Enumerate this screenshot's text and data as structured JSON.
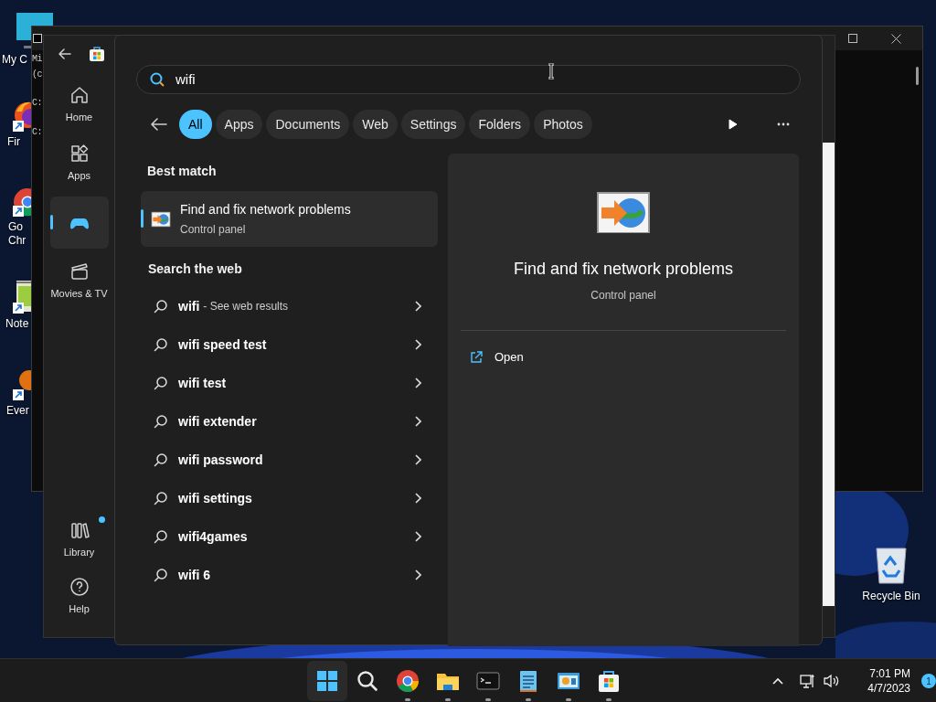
{
  "desktop": {
    "icons": [
      {
        "kind": "computer",
        "label_lines": [
          "My C"
        ]
      },
      {
        "kind": "firefox",
        "label_lines": [
          "Fir"
        ]
      },
      {
        "kind": "chrome",
        "label_lines": [
          "Go",
          "Chr"
        ]
      },
      {
        "kind": "notepad",
        "label_lines": [
          "Note"
        ]
      },
      {
        "kind": "everything",
        "label_lines": [
          "Ever"
        ]
      }
    ],
    "recycle_bin": {
      "label": "Recycle Bin"
    }
  },
  "console_window": {
    "lines": [
      "Mi",
      "(c",
      "C:",
      "C:"
    ]
  },
  "store_window": {
    "nav": [
      {
        "kind": "home",
        "label": "Home",
        "selected": false
      },
      {
        "kind": "apps",
        "label": "Apps",
        "selected": false
      },
      {
        "kind": "gaming",
        "selected": true
      },
      {
        "kind": "movies",
        "label": "Movies & TV",
        "selected": false
      }
    ],
    "bottom_nav": [
      {
        "kind": "library",
        "label": "Library",
        "badge": true
      },
      {
        "kind": "help",
        "label": "Help",
        "badge": false
      }
    ]
  },
  "search": {
    "value": "wifi",
    "filters": [
      {
        "label": "All",
        "selected": true
      },
      {
        "label": "Apps",
        "selected": false
      },
      {
        "label": "Documents",
        "selected": false
      },
      {
        "label": "Web",
        "selected": false
      },
      {
        "label": "Settings",
        "selected": false
      },
      {
        "label": "Folders",
        "selected": false
      },
      {
        "label": "Photos",
        "selected": false
      }
    ],
    "best_match": {
      "heading": "Best match",
      "title": "Find and fix network problems",
      "subtitle": "Control panel",
      "selected": true
    },
    "web": {
      "heading": "Search the web",
      "items": [
        {
          "query": "wifi",
          "suffix": "- See web results"
        },
        {
          "query": "wifi speed test"
        },
        {
          "query": "wifi test"
        },
        {
          "query": "wifi extender"
        },
        {
          "query": "wifi password"
        },
        {
          "query": "wifi settings"
        },
        {
          "query": "wifi4games"
        },
        {
          "query": "wifi 6"
        }
      ]
    },
    "preview": {
      "title": "Find and fix network problems",
      "subtitle": "Control panel",
      "actions": [
        {
          "label": "Open"
        }
      ]
    }
  },
  "taskbar": {
    "apps": [
      {
        "kind": "start",
        "running": false
      },
      {
        "kind": "search",
        "running": false
      },
      {
        "kind": "chrome",
        "running": true
      },
      {
        "kind": "explorer",
        "running": true
      },
      {
        "kind": "terminal",
        "running": true
      },
      {
        "kind": "notepad",
        "running": true
      },
      {
        "kind": "control",
        "running": true
      },
      {
        "kind": "store",
        "running": true
      }
    ],
    "clock": {
      "time": "7:01 PM",
      "date": "4/7/2023"
    },
    "notification_count": "1"
  }
}
